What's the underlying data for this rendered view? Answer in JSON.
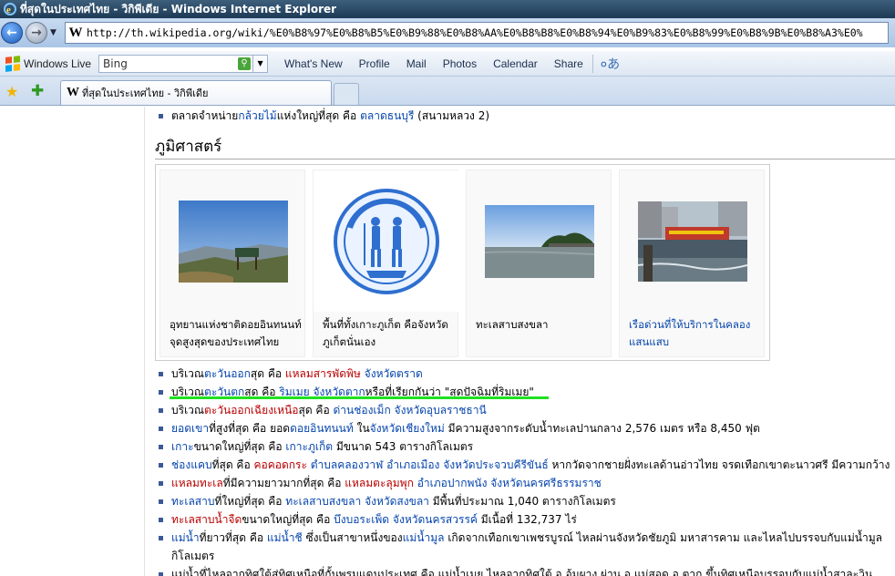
{
  "window": {
    "title": "ที่สุดในประเทศไทย - วิกิพีเดีย - Windows Internet Explorer"
  },
  "address": {
    "url": "http://th.wikipedia.org/wiki/%E0%B8%97%E0%B8%B5%E0%B9%88%E0%B8%AA%E0%B8%B8%E0%B8%94%E0%B9%83%E0%B8%99%E0%B8%9B%E0%B8%A3%E0%"
  },
  "linksbar": {
    "brand": "Windows Live",
    "search_value": "Bing",
    "links": [
      "What's New",
      "Profile",
      "Mail",
      "Photos",
      "Calendar",
      "Share"
    ]
  },
  "tab": {
    "title": "ที่สุดในประเทศไทย - วิกิพีเดีย"
  },
  "content": {
    "top_item": {
      "pre": "ตลาดจำหน่าย",
      "link1": "กล้วยไม้",
      "mid": "แห่งใหญ่ที่สุด คือ ",
      "link2": "ตลาดธนบุรี",
      "post": " (สนามหลวง 2)"
    },
    "heading": "ภูมิศาสตร์",
    "gallery": [
      {
        "caption1": "อุทยานแห่งชาติดอยอินทนนท์",
        "caption2": "จุดสูงสุดของประเทศไทย"
      },
      {
        "caption1": "พื้นที่ทั้งเกาะภูเก็ต คือจังหวัด",
        "caption2": "ภูเก็ตนั่นเอง"
      },
      {
        "caption1": "ทะเลสาบสงขลา",
        "caption2": ""
      },
      {
        "caption1": "เรือด่วนที่ให้บริการในคลอง",
        "caption2": "แสนแสบ"
      }
    ],
    "items": [
      {
        "a": "บริเวณ",
        "b": "ตะวันออก",
        "c": "สุด คือ ",
        "d": "แหลมสารพัดพิษ",
        "e": " ",
        "f": "จังหวัดตราด",
        "g": ""
      },
      {
        "a": "บริเวณ",
        "b": "ตะวันตก",
        "c": "สุด คือ ",
        "d": "ริมเมย",
        "e": " ",
        "f": "จังหวัดตาก",
        "g": "หรือที่เรียกกันว่า \"สุดปัจฉิมที่ริมเมย\""
      },
      {
        "a": "บริเวณ",
        "b": "ตะวันออกเฉียงเหนือ",
        "c": "สุด คือ ",
        "d": "ด่านช่องเม็ก",
        "e": " ",
        "f": "จังหวัดอุบลราชธานี",
        "g": ""
      },
      {
        "a": "",
        "b": "ยอดเขา",
        "c": "ที่สูงที่สุด คือ ยอด",
        "d": "ดอยอินทนนท์",
        "e": " ใน",
        "f": "จังหวัดเชียงใหม่",
        "g": " มีความสูงจากระดับน้ำทะเลปานกลาง 2,576 เมตร หรือ 8,450 ฟุต"
      },
      {
        "a": "",
        "b": "เกาะ",
        "c": "ขนาดใหญ่ที่สุด คือ ",
        "d": "เกาะภูเก็ต",
        "e": "",
        "f": "",
        "g": " มีขนาด 543 ตารางกิโลเมตร"
      },
      {
        "a": "",
        "b": "ช่องแคบ",
        "c": "ที่สุด คือ ",
        "d": "คอคอดกระ",
        "e": " ",
        "f": "ตำบลคลองวาฬ อำเภอเมือง จังหวัดประจวบคีรีขันธ์",
        "g": " หากวัดจากชายฝั่งทะเลด้านอ่าวไทย จรดเทือกเขาตะนาวศรี มีความกว้าง"
      },
      {
        "a": "",
        "b": "แหลมทะเล",
        "c": "ที่มีความยาวมากที่สุด คือ ",
        "d": "แหลมตะลุมพุก",
        "e": " ",
        "f": "อำเภอปากพนัง จังหวัดนครศรีธรรมราช",
        "g": ""
      },
      {
        "a": "",
        "b": "ทะเลสาบ",
        "c": "ที่ใหญ่ที่สุด คือ ",
        "d": "ทะเลสาบสงขลา",
        "e": " ",
        "f": "จังหวัดสงขลา",
        "g": " มีพื้นที่ประมาณ 1,040 ตารางกิโลเมตร"
      },
      {
        "a": "",
        "b": "ทะเลสาบน้ำจืด",
        "c": "ขนาดใหญ่ที่สุด คือ ",
        "d": "บึงบอระเพ็ด",
        "e": " ",
        "f": "จังหวัดนครสวรรค์",
        "g": " มีเนื้อที่ 132,737 ไร่"
      },
      {
        "a": "",
        "b": "แม่น้ำ",
        "c": "ที่ยาวที่สุด คือ ",
        "d": "แม่น้ำชี",
        "e": " ซึ่งเป็นสาขาหนึ่งของ",
        "f": "แม่น้ำมูล",
        "g": " เกิดจากเทือกเขาเพชรบูรณ์ ไหลผ่านจังหวัดชัยภูมิ มหาสารคาม และไหลไปบรรจบกับแม่น้ำมูล"
      }
    ],
    "wrap_text": "กิโลเมตร",
    "last_item": "แม่น้ำที่ไหลจากทิศใต้สู่ทิศเหนือที่กั้นพรมแดนประเทศ คือ แม่น้ำเมย ไหลจากทิศใต้ อ.อุ้มผาง ผ่าน อ.แม่สอด อ.ตาก ขึ้นทิศเหนือบรรจบกับแม่น้ำสาละวิน"
  }
}
